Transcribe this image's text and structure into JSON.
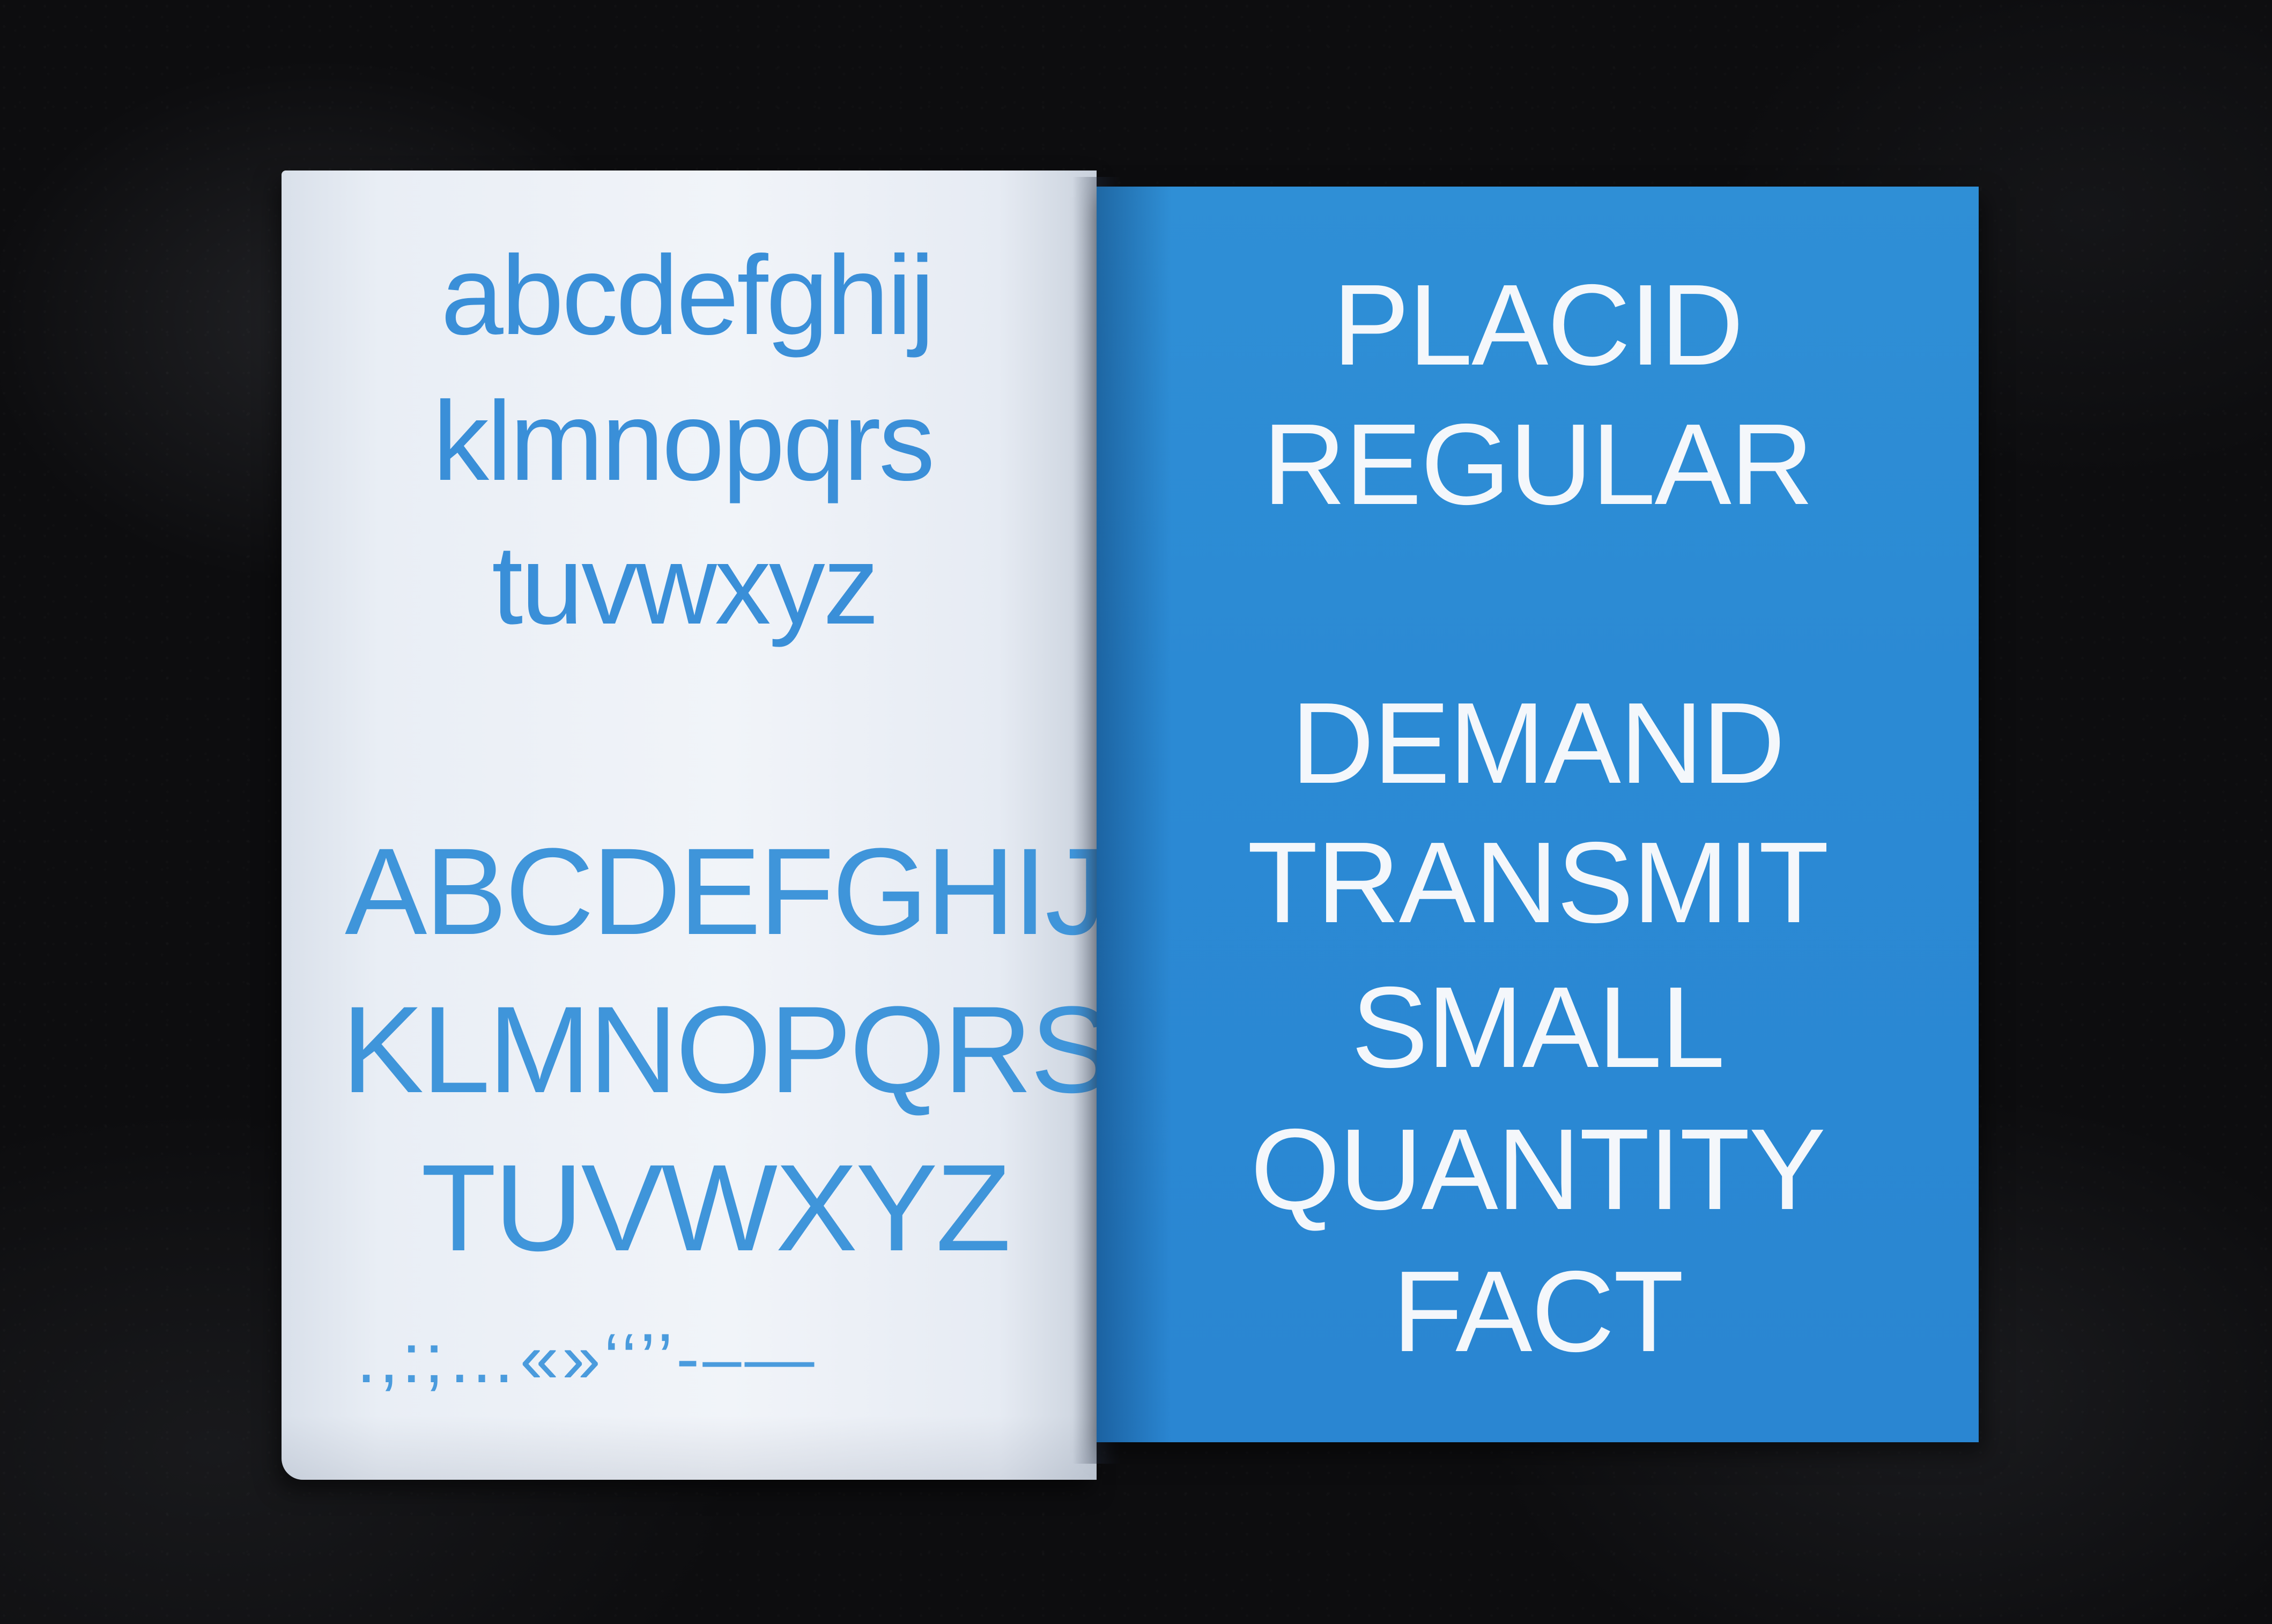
{
  "left_page": {
    "lowercase_lines": [
      "abcdefghij",
      "klmnopqrs",
      "tuvwxyz"
    ],
    "uppercase_lines": [
      "ABCDEFGHIJ",
      "KLMNOPQRS",
      "TUVWXYZ"
    ],
    "punctuation_line": ".,:;…«»‘‘’’-–—",
    "text_color": "#3a8fd8",
    "paper_color": "#eef2f8"
  },
  "right_page": {
    "title_lines": [
      "PLACID",
      "REGULAR"
    ],
    "word_lines": [
      "DEMAND",
      "TRANSMIT",
      "SMALL",
      "QUANTITY",
      "FACT"
    ],
    "text_color": "#f4f7fb",
    "paper_color": "#2b8ad4"
  },
  "background": {
    "material": "black leather",
    "color": "#0d0d0f"
  }
}
